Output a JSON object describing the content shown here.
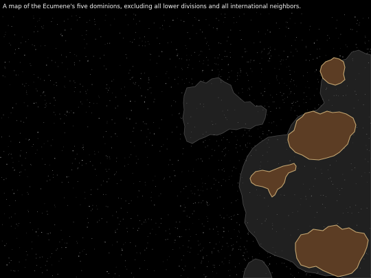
{
  "caption": "A map of the Ecumene's five dominions, excluding all lower divisions and all international neighbors.",
  "colors": {
    "background": "#000000",
    "landmass": "#202020",
    "dominion_fill": "#5c3d24",
    "dominion_border": "#d2b27a",
    "caption_text": "#f0f0f0",
    "stars": "#d8d8d8"
  }
}
